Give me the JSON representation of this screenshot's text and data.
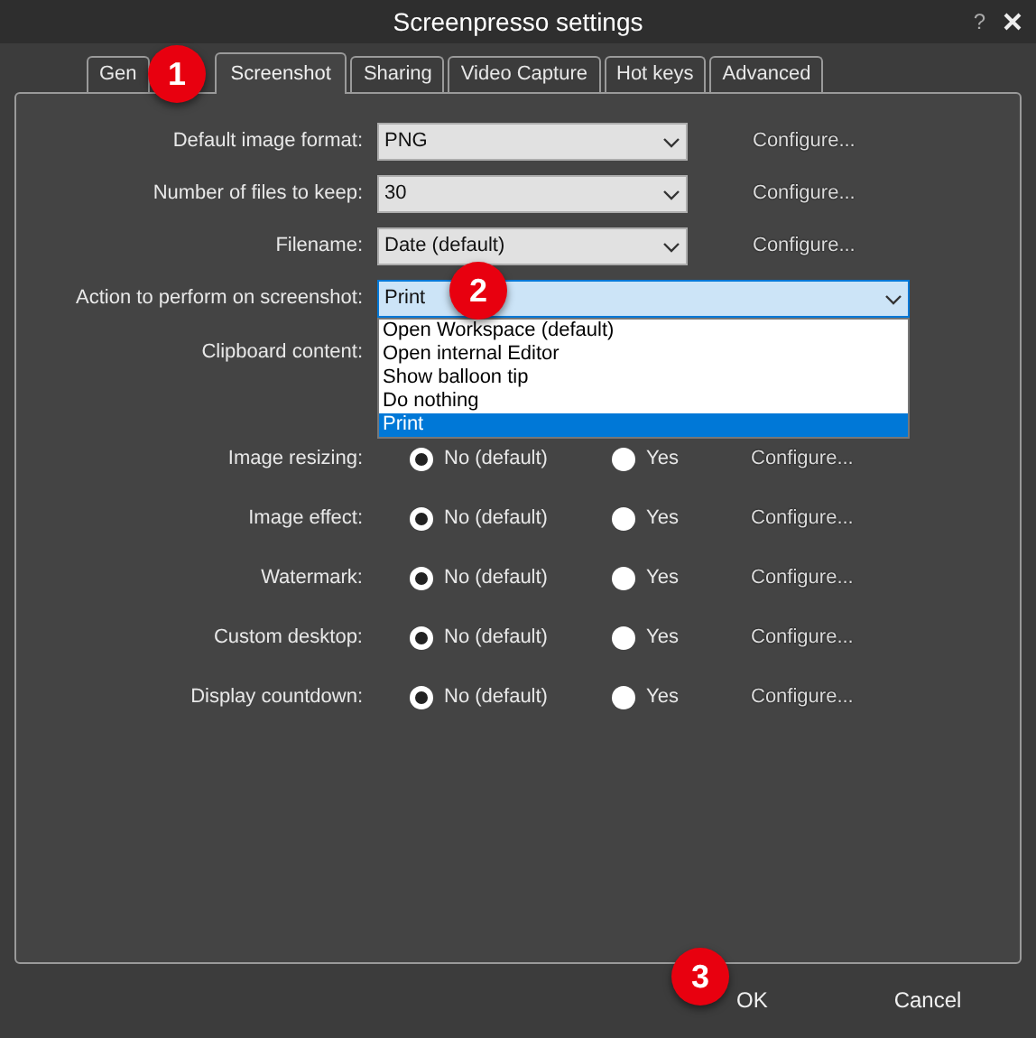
{
  "window": {
    "title": "Screenpresso settings",
    "help": "?"
  },
  "tabs": [
    {
      "label": "Gen",
      "selected": false
    },
    {
      "label": "Screenshot",
      "selected": true
    },
    {
      "label": "Sharing",
      "selected": false
    },
    {
      "label": "Video Capture",
      "selected": false
    },
    {
      "label": "Hot keys",
      "selected": false
    },
    {
      "label": "Advanced",
      "selected": false
    }
  ],
  "combo_rows": [
    {
      "label": "Default image format:",
      "value": "PNG",
      "link": "Configure...",
      "expanded": false
    },
    {
      "label": "Number of files to keep:",
      "value": "30",
      "link": "Configure...",
      "expanded": false
    },
    {
      "label": "Filename:",
      "value": "Date (default)",
      "link": "Configure...",
      "expanded": false
    },
    {
      "label": "Action to perform on screenshot:",
      "value": "Print",
      "expanded": true,
      "options": [
        {
          "label": "Open Workspace (default)",
          "selected": false
        },
        {
          "label": "Open internal Editor",
          "selected": false
        },
        {
          "label": "Show balloon tip",
          "selected": false
        },
        {
          "label": "Do nothing",
          "selected": false
        },
        {
          "label": "Print",
          "selected": true
        }
      ]
    }
  ],
  "clipboard_label": "Clipboard content:",
  "radio_rows": [
    {
      "label": "Image resizing:",
      "options": [
        {
          "label": "No (default)",
          "selected": true
        },
        {
          "label": "Yes",
          "selected": false
        }
      ],
      "link": "Configure..."
    },
    {
      "label": "Image effect:",
      "options": [
        {
          "label": "No (default)",
          "selected": true
        },
        {
          "label": "Yes",
          "selected": false
        }
      ],
      "link": "Configure..."
    },
    {
      "label": "Watermark:",
      "options": [
        {
          "label": "No (default)",
          "selected": true
        },
        {
          "label": "Yes",
          "selected": false
        }
      ],
      "link": "Configure..."
    },
    {
      "label": "Custom desktop:",
      "options": [
        {
          "label": "No (default)",
          "selected": true
        },
        {
          "label": "Yes",
          "selected": false
        }
      ],
      "link": "Configure..."
    },
    {
      "label": "Display countdown:",
      "options": [
        {
          "label": "No (default)",
          "selected": true
        },
        {
          "label": "Yes",
          "selected": false
        }
      ],
      "link": "Configure..."
    }
  ],
  "buttons": [
    "OK",
    "Cancel"
  ],
  "annotations": [
    "1",
    "2",
    "3"
  ]
}
